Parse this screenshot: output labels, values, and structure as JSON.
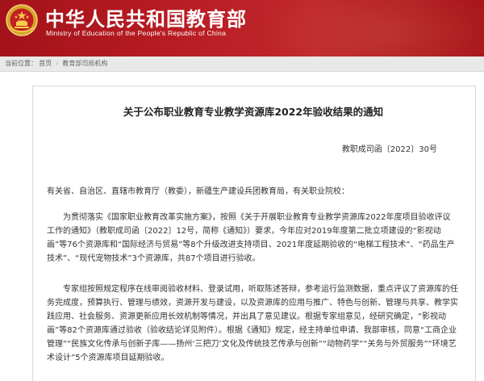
{
  "header": {
    "title_cn": "中华人民共和国教育部",
    "title_en": "Ministry of Education of the People's Republic of China",
    "colors": {
      "banner": "#b71c22",
      "emblem_gold": "#e8b93a"
    }
  },
  "breadcrumb": {
    "current_label": "当前位置：",
    "items": [
      "首页",
      "教育部司局机构"
    ],
    "separator": "›"
  },
  "article": {
    "title": "关于公布职业教育专业教学资源库2022年验收结果的通知",
    "doc_number": "教职成司函〔2022〕30号",
    "salutation": "有关省、自治区、直辖市教育厅（教委），新疆生产建设兵团教育局，有关职业院校：",
    "paragraph1": "为贯彻落实《国家职业教育改革实施方案》，按照《关于开展职业教育专业教学资源库2022年度项目验收评议工作的通知》（教职成司函〔2022〕12号，简称《通知》）要求，今年应对2019年度第二批立项建设的“影视动画”等76个资源库和“国际经济与贸易”等8个升级改进支持项目、2021年度延期验收的“电梯工程技术”、“药品生产技术”、“现代宠物技术”3个资源库，共87个项目进行验收。",
    "paragraph2": "专家组按照规定程序在线审阅验收材料、登录试用，听取陈述答辩，参考运行监测数据，重点评议了资源库的任务完成度，预算执行、管理与绩效，资源开发与建设，以及资源库的应用与推广、特色与创新、管理与共享、教学实践应用、社会服务、资源更新应用长效机制等情况，并出具了意见建议。根据专家组意见，经研究确定，“影视动画”等82个资源库通过验收（验收结论详见附件）。根据《通知》规定，经主持单位申请、我部审核，同意“工商企业管理”“民族文化传承与创新子库——扬州‘三把刀’文化及传统技艺传承与创新”“动物药学”“关务与外贸服务”“环境艺术设计”5个资源库项目延期验收。"
  }
}
